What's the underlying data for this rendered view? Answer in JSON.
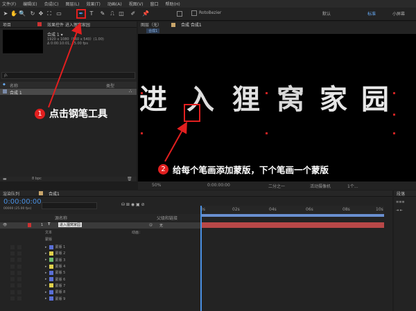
{
  "menu": [
    "文件(F)",
    "编辑(E)",
    "合成(C)",
    "图层(L)",
    "效果(T)",
    "动画(A)",
    "视图(V)",
    "窗口",
    "帮助(H)"
  ],
  "toolbar": {
    "rotobezier": "RotoBezier",
    "default": "默认",
    "standard": "标准",
    "small_screen": "小屏幕"
  },
  "project_panel": {
    "tab": "项目",
    "effects_tab": "效果控件 进入狸窝家园",
    "comp_name": "合成 1 ▾",
    "comp_info1": "1920 x 1080（960 x 540）(1.00)",
    "comp_info2": "Δ 0:00:10:01, 25.00 fps",
    "search_placeholder": "ρ.",
    "col_name": "名称",
    "col_type": "类型",
    "item": "合成 1",
    "bpc": "8 bpc"
  },
  "comp_panel": {
    "layer_tab": "图层（无）",
    "comp_tab": "合成 合成1",
    "sub_tab": "合成1",
    "title_chars": [
      "进",
      "入",
      "狸",
      "窝",
      "家",
      "园"
    ],
    "zoom": "50%",
    "timecode": "0:00:00:00",
    "half": "二分之一",
    "camera": "活动摄像机",
    "views": "1个..."
  },
  "callouts": {
    "one_num": "1",
    "one": "点击钢笔工具",
    "two_num": "2",
    "two": "给每个笔画添加蒙版，下个笔画一个蒙版"
  },
  "timeline": {
    "render_tab": "渲染队列",
    "comp_tab": "合成1",
    "timecode": "0:00:00:00",
    "frames": "00000 (25.00 fps)",
    "col_name": "源名称",
    "col_parent": "父级和链接",
    "ruler": [
      "0s",
      "02s",
      "04s",
      "06s",
      "08s",
      "10s"
    ],
    "main_layer": {
      "num": "1",
      "label": "进入狸窝家园",
      "parent": "无"
    },
    "text_label": "文本",
    "anim_label": "动画：",
    "masks_label": "蒙版",
    "masks": [
      {
        "label": "蒙版 1",
        "color": "#5a6fd6"
      },
      {
        "label": "蒙版 2",
        "color": "#e0d04a"
      },
      {
        "label": "蒙版 3",
        "color": "#6dbb6d"
      },
      {
        "label": "蒙版 4",
        "color": "#e0d04a"
      },
      {
        "label": "蒙版 5",
        "color": "#5a6fd6"
      },
      {
        "label": "蒙版 6",
        "color": "#5a6fd6"
      },
      {
        "label": "蒙版 7",
        "color": "#e0d04a"
      },
      {
        "label": "蒙版 8",
        "color": "#5a6fd6"
      },
      {
        "label": "蒙版 9",
        "color": "#5a6fd6"
      }
    ]
  },
  "right_panel": {
    "tab": "段落"
  }
}
